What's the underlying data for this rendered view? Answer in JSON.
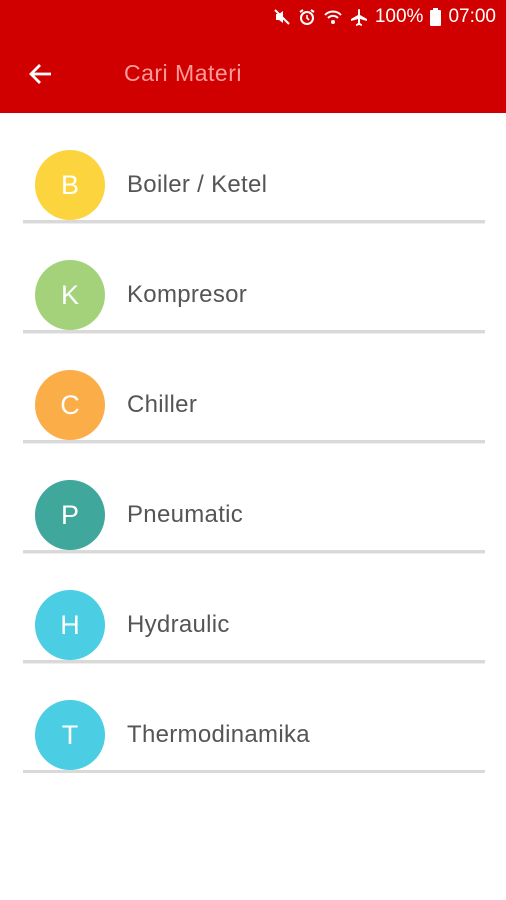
{
  "status_bar": {
    "battery_text": "100%",
    "time": "07:00",
    "icons": [
      "mute-icon",
      "alarm-icon",
      "wifi-icon",
      "airplane-icon",
      "battery-icon"
    ]
  },
  "app_bar": {
    "title": "Cari Materi",
    "back_icon": "back-arrow-icon",
    "background_color": "#d10000",
    "title_color": "#ff9a9a"
  },
  "items": [
    {
      "letter": "B",
      "label": "Boiler / Ketel",
      "color": "#fcd53e"
    },
    {
      "letter": "K",
      "label": "Kompresor",
      "color": "#a4d27a"
    },
    {
      "letter": "C",
      "label": "Chiller",
      "color": "#fbad48"
    },
    {
      "letter": "P",
      "label": "Pneumatic",
      "color": "#3fa79b"
    },
    {
      "letter": "H",
      "label": "Hydraulic",
      "color": "#4bcde3"
    },
    {
      "letter": "T",
      "label": "Thermodinamika",
      "color": "#4bcde3"
    }
  ]
}
